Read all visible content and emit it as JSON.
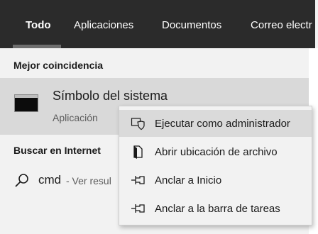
{
  "tabs": [
    {
      "label": "Todo",
      "active": true
    },
    {
      "label": "Aplicaciones",
      "active": false
    },
    {
      "label": "Documentos",
      "active": false
    },
    {
      "label": "Correo electr",
      "active": false
    }
  ],
  "best_match": {
    "heading": "Mejor coincidencia",
    "icon": "command-prompt-icon",
    "title": "Símbolo del sistema",
    "subtitle": "Aplicación"
  },
  "web_search": {
    "heading": "Buscar en Internet",
    "icon": "search-icon",
    "query": "cmd",
    "hint": "- Ver resul"
  },
  "context_menu": {
    "items": [
      {
        "label": "Ejecutar como administrador",
        "icon": "shield-icon",
        "highlighted": true
      },
      {
        "label": "Abrir ubicación de archivo",
        "icon": "file-location-icon",
        "highlighted": false
      },
      {
        "label": "Anclar a Inicio",
        "icon": "pin-icon",
        "highlighted": false
      },
      {
        "label": "Anclar a la barra de tareas",
        "icon": "pin-icon",
        "highlighted": false
      }
    ]
  },
  "colors": {
    "tab_bar": "#2b2b2b",
    "panel": "#f2f2f2",
    "selected": "#d9d9d9",
    "menu_hover": "#dadada"
  }
}
